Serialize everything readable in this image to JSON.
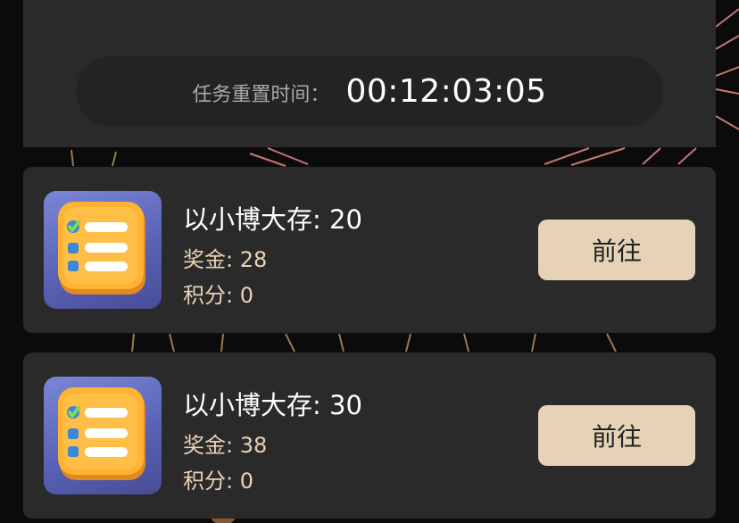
{
  "timer": {
    "label": "任务重置时间：",
    "value": "00:12:03:05"
  },
  "tasks": [
    {
      "title": "以小博大存: 20",
      "bonus": "奖金: 28",
      "points": "积分: 0",
      "button_label": "前往",
      "icon": "checklist-icon"
    },
    {
      "title": "以小博大存: 30",
      "bonus": "奖金: 38",
      "points": "积分: 0",
      "button_label": "前往",
      "icon": "checklist-icon"
    }
  ],
  "colors": {
    "panel": "#2a2a2a",
    "accent_button": "#e6d3b7",
    "gold_text": "#e9d3b4"
  }
}
